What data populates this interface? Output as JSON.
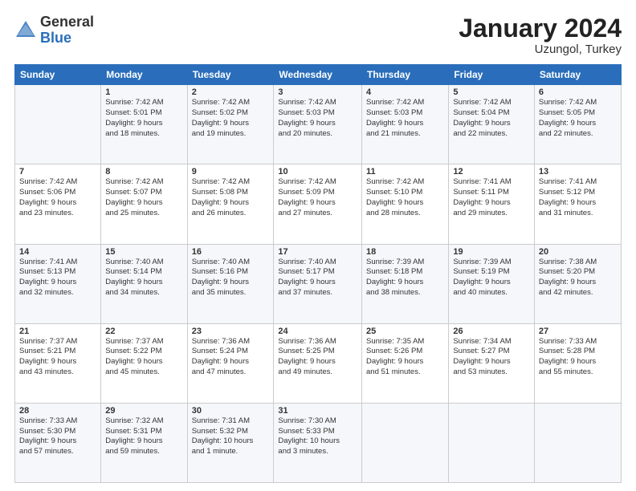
{
  "header": {
    "logo_general": "General",
    "logo_blue": "Blue",
    "title": "January 2024",
    "subtitle": "Uzungol, Turkey"
  },
  "days_header": [
    "Sunday",
    "Monday",
    "Tuesday",
    "Wednesday",
    "Thursday",
    "Friday",
    "Saturday"
  ],
  "weeks": [
    [
      {
        "num": "",
        "detail": ""
      },
      {
        "num": "1",
        "detail": "Sunrise: 7:42 AM\nSunset: 5:01 PM\nDaylight: 9 hours\nand 18 minutes."
      },
      {
        "num": "2",
        "detail": "Sunrise: 7:42 AM\nSunset: 5:02 PM\nDaylight: 9 hours\nand 19 minutes."
      },
      {
        "num": "3",
        "detail": "Sunrise: 7:42 AM\nSunset: 5:03 PM\nDaylight: 9 hours\nand 20 minutes."
      },
      {
        "num": "4",
        "detail": "Sunrise: 7:42 AM\nSunset: 5:03 PM\nDaylight: 9 hours\nand 21 minutes."
      },
      {
        "num": "5",
        "detail": "Sunrise: 7:42 AM\nSunset: 5:04 PM\nDaylight: 9 hours\nand 22 minutes."
      },
      {
        "num": "6",
        "detail": "Sunrise: 7:42 AM\nSunset: 5:05 PM\nDaylight: 9 hours\nand 22 minutes."
      }
    ],
    [
      {
        "num": "7",
        "detail": "Sunrise: 7:42 AM\nSunset: 5:06 PM\nDaylight: 9 hours\nand 23 minutes."
      },
      {
        "num": "8",
        "detail": "Sunrise: 7:42 AM\nSunset: 5:07 PM\nDaylight: 9 hours\nand 25 minutes."
      },
      {
        "num": "9",
        "detail": "Sunrise: 7:42 AM\nSunset: 5:08 PM\nDaylight: 9 hours\nand 26 minutes."
      },
      {
        "num": "10",
        "detail": "Sunrise: 7:42 AM\nSunset: 5:09 PM\nDaylight: 9 hours\nand 27 minutes."
      },
      {
        "num": "11",
        "detail": "Sunrise: 7:42 AM\nSunset: 5:10 PM\nDaylight: 9 hours\nand 28 minutes."
      },
      {
        "num": "12",
        "detail": "Sunrise: 7:41 AM\nSunset: 5:11 PM\nDaylight: 9 hours\nand 29 minutes."
      },
      {
        "num": "13",
        "detail": "Sunrise: 7:41 AM\nSunset: 5:12 PM\nDaylight: 9 hours\nand 31 minutes."
      }
    ],
    [
      {
        "num": "14",
        "detail": "Sunrise: 7:41 AM\nSunset: 5:13 PM\nDaylight: 9 hours\nand 32 minutes."
      },
      {
        "num": "15",
        "detail": "Sunrise: 7:40 AM\nSunset: 5:14 PM\nDaylight: 9 hours\nand 34 minutes."
      },
      {
        "num": "16",
        "detail": "Sunrise: 7:40 AM\nSunset: 5:16 PM\nDaylight: 9 hours\nand 35 minutes."
      },
      {
        "num": "17",
        "detail": "Sunrise: 7:40 AM\nSunset: 5:17 PM\nDaylight: 9 hours\nand 37 minutes."
      },
      {
        "num": "18",
        "detail": "Sunrise: 7:39 AM\nSunset: 5:18 PM\nDaylight: 9 hours\nand 38 minutes."
      },
      {
        "num": "19",
        "detail": "Sunrise: 7:39 AM\nSunset: 5:19 PM\nDaylight: 9 hours\nand 40 minutes."
      },
      {
        "num": "20",
        "detail": "Sunrise: 7:38 AM\nSunset: 5:20 PM\nDaylight: 9 hours\nand 42 minutes."
      }
    ],
    [
      {
        "num": "21",
        "detail": "Sunrise: 7:37 AM\nSunset: 5:21 PM\nDaylight: 9 hours\nand 43 minutes."
      },
      {
        "num": "22",
        "detail": "Sunrise: 7:37 AM\nSunset: 5:22 PM\nDaylight: 9 hours\nand 45 minutes."
      },
      {
        "num": "23",
        "detail": "Sunrise: 7:36 AM\nSunset: 5:24 PM\nDaylight: 9 hours\nand 47 minutes."
      },
      {
        "num": "24",
        "detail": "Sunrise: 7:36 AM\nSunset: 5:25 PM\nDaylight: 9 hours\nand 49 minutes."
      },
      {
        "num": "25",
        "detail": "Sunrise: 7:35 AM\nSunset: 5:26 PM\nDaylight: 9 hours\nand 51 minutes."
      },
      {
        "num": "26",
        "detail": "Sunrise: 7:34 AM\nSunset: 5:27 PM\nDaylight: 9 hours\nand 53 minutes."
      },
      {
        "num": "27",
        "detail": "Sunrise: 7:33 AM\nSunset: 5:28 PM\nDaylight: 9 hours\nand 55 minutes."
      }
    ],
    [
      {
        "num": "28",
        "detail": "Sunrise: 7:33 AM\nSunset: 5:30 PM\nDaylight: 9 hours\nand 57 minutes."
      },
      {
        "num": "29",
        "detail": "Sunrise: 7:32 AM\nSunset: 5:31 PM\nDaylight: 9 hours\nand 59 minutes."
      },
      {
        "num": "30",
        "detail": "Sunrise: 7:31 AM\nSunset: 5:32 PM\nDaylight: 10 hours\nand 1 minute."
      },
      {
        "num": "31",
        "detail": "Sunrise: 7:30 AM\nSunset: 5:33 PM\nDaylight: 10 hours\nand 3 minutes."
      },
      {
        "num": "",
        "detail": ""
      },
      {
        "num": "",
        "detail": ""
      },
      {
        "num": "",
        "detail": ""
      }
    ]
  ]
}
